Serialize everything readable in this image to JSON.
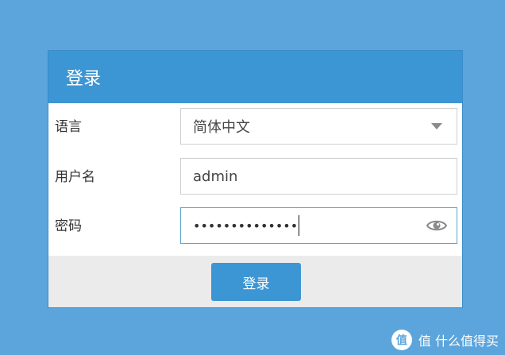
{
  "panel": {
    "title": "登录"
  },
  "form": {
    "language": {
      "label": "语言",
      "value": "简体中文"
    },
    "username": {
      "label": "用户名",
      "value": "admin"
    },
    "password": {
      "label": "密码",
      "value": "••••••••••••••"
    }
  },
  "footer": {
    "login_label": "登录"
  },
  "watermark": {
    "text": "值 什么值得买",
    "logo_char": "值"
  },
  "icons": {
    "dropdown": "chevron-down-icon",
    "show_password": "eye-icon"
  },
  "colors": {
    "background": "#5ba5dc",
    "header": "#3d96d4",
    "button": "#3d96d4"
  }
}
